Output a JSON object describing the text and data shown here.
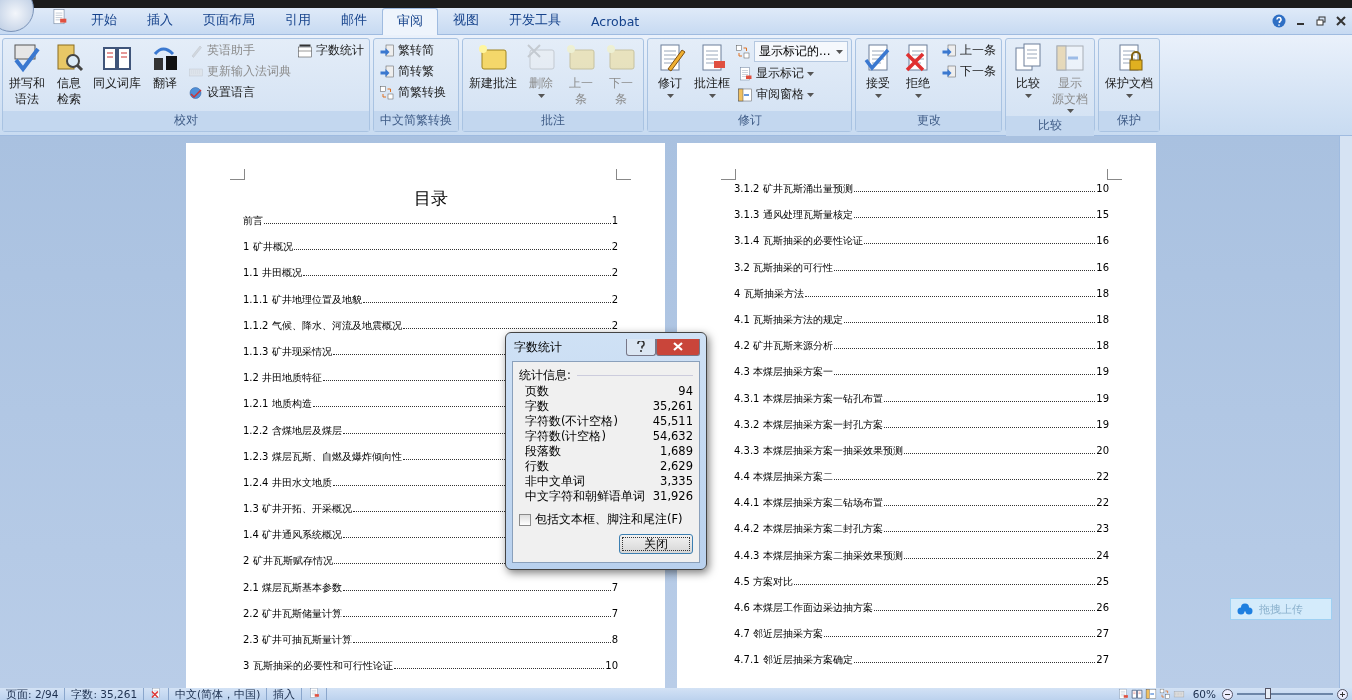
{
  "tabs": [
    {
      "label": "开始",
      "selected": false
    },
    {
      "label": "插入",
      "selected": false
    },
    {
      "label": "页面布局",
      "selected": false
    },
    {
      "label": "引用",
      "selected": false
    },
    {
      "label": "邮件",
      "selected": false
    },
    {
      "label": "审阅",
      "selected": true
    },
    {
      "label": "视图",
      "selected": false
    },
    {
      "label": "开发工具",
      "selected": false
    },
    {
      "label": "Acrobat",
      "selected": false
    }
  ],
  "ribbon": {
    "groups": [
      {
        "label": "校对",
        "columns": [
          [
            {
              "kind": "large",
              "label": [
                "拼写和",
                "语法"
              ],
              "disabled": false,
              "has_menu": false
            }
          ],
          [
            {
              "kind": "large",
              "label": [
                "信息",
                "检索"
              ],
              "disabled": false,
              "has_menu": false
            }
          ],
          [
            {
              "kind": "large",
              "label": "同义词库",
              "disabled": false,
              "has_menu": false
            }
          ],
          [
            {
              "kind": "large",
              "label": "翻译",
              "disabled": false,
              "has_menu": false
            }
          ],
          [
            {
              "kind": "small",
              "label": "英语助手",
              "disabled": true,
              "has_menu": false
            },
            {
              "kind": "small",
              "label": "更新输入法词典",
              "disabled": true,
              "has_menu": false
            },
            {
              "kind": "small",
              "label": "设置语言",
              "disabled": false,
              "has_menu": false
            }
          ],
          [
            {
              "kind": "small",
              "label": "字数统计",
              "disabled": false,
              "has_menu": false
            }
          ]
        ]
      },
      {
        "label": "中文简繁转换",
        "columns": [
          [
            {
              "kind": "small",
              "label": "繁转简",
              "disabled": false,
              "has_menu": false
            },
            {
              "kind": "small",
              "label": "简转繁",
              "disabled": false,
              "has_menu": false
            },
            {
              "kind": "small",
              "label": "简繁转换",
              "disabled": false,
              "has_menu": false
            }
          ]
        ]
      },
      {
        "label": "批注",
        "columns": [
          [
            {
              "kind": "large",
              "label": "新建批注",
              "disabled": false,
              "has_menu": false
            }
          ],
          [
            {
              "kind": "large",
              "label": "删除",
              "disabled": true,
              "has_menu": true
            }
          ],
          [
            {
              "kind": "large",
              "label": [
                "上一",
                "条"
              ],
              "disabled": true,
              "has_menu": false
            }
          ],
          [
            {
              "kind": "large",
              "label": [
                "下一",
                "条"
              ],
              "disabled": true,
              "has_menu": false
            }
          ]
        ]
      },
      {
        "label": "修订",
        "columns": [
          [
            {
              "kind": "large",
              "label": "修订",
              "disabled": false,
              "has_menu": true
            }
          ],
          [
            {
              "kind": "large",
              "label": "批注框",
              "disabled": false,
              "has_menu": true
            }
          ],
          [
            {
              "kind": "combo",
              "label": "显示标记的...",
              "disabled": false,
              "has_menu": true
            },
            {
              "kind": "small",
              "label": "显示标记",
              "disabled": false,
              "has_menu": true
            },
            {
              "kind": "small",
              "label": "审阅窗格",
              "disabled": false,
              "has_menu": true
            }
          ]
        ]
      },
      {
        "label": "更改",
        "columns": [
          [
            {
              "kind": "large",
              "label": "接受",
              "disabled": false,
              "has_menu": true
            }
          ],
          [
            {
              "kind": "large",
              "label": "拒绝",
              "disabled": false,
              "has_menu": true
            }
          ],
          [
            {
              "kind": "small",
              "label": "上一条",
              "disabled": false,
              "has_menu": false
            },
            {
              "kind": "small",
              "label": "下一条",
              "disabled": false,
              "has_menu": false
            }
          ]
        ]
      },
      {
        "label": "比较",
        "columns": [
          [
            {
              "kind": "large",
              "label": "比较",
              "disabled": false,
              "has_menu": true
            }
          ],
          [
            {
              "kind": "large",
              "label": [
                "显示",
                "源文档"
              ],
              "disabled": true,
              "has_menu": true
            }
          ]
        ]
      },
      {
        "label": "保护",
        "columns": [
          [
            {
              "kind": "large",
              "label": "保护文档",
              "disabled": false,
              "has_menu": true
            }
          ]
        ]
      }
    ]
  },
  "pages": [
    {
      "heading": "目录",
      "entries": [
        {
          "title": "前言",
          "page": "1"
        },
        {
          "title": "1  矿井概况",
          "page": "2"
        },
        {
          "title": "1.1 井田概况",
          "page": "2"
        },
        {
          "title": "1.1.1 矿井地理位置及地貌",
          "page": "2"
        },
        {
          "title": "1.1.2 气候、降水、河流及地震概况",
          "page": "2"
        },
        {
          "title": "1.1.3 矿井现采情况"
        },
        {
          "title": "1.2 井田地质特征"
        },
        {
          "title": "1.2.1 地质构造"
        },
        {
          "title": "1.2.2 含煤地层及煤层"
        },
        {
          "title": "1.2.3 煤层瓦斯、自燃及爆炸倾向性"
        },
        {
          "title": "1.2.4 井田水文地质"
        },
        {
          "title": "1.3 矿井开拓、开采概况"
        },
        {
          "title": "1.4 矿井通风系统概况"
        },
        {
          "title": "2  矿井瓦斯赋存情况"
        },
        {
          "title": "2.1 煤层瓦斯基本参数",
          "page": "7"
        },
        {
          "title": "2.2 矿井瓦斯储量计算",
          "page": "7"
        },
        {
          "title": "2.3 矿井可抽瓦斯量计算",
          "page": "8"
        },
        {
          "title": "3  瓦斯抽采的必要性和可行性论证",
          "page": "10"
        }
      ]
    },
    {
      "entries": [
        {
          "title": "3.1.2 矿井瓦斯涌出量预测",
          "page": "10"
        },
        {
          "title": "3.1.3 通风处理瓦斯量核定",
          "page": "15"
        },
        {
          "title": "3.1.4 瓦斯抽采的必要性论证",
          "page": "16"
        },
        {
          "title": "3.2 瓦斯抽采的可行性",
          "page": "16"
        },
        {
          "title": "4  瓦斯抽采方法",
          "page": "18"
        },
        {
          "title": "4.1 瓦斯抽采方法的规定",
          "page": "18"
        },
        {
          "title": "4.2 矿井瓦斯来源分析",
          "page": "18"
        },
        {
          "title": "4.3 本煤层抽采方案一",
          "page": "19"
        },
        {
          "title": "4.3.1 本煤层抽采方案一钻孔布置",
          "page": "19"
        },
        {
          "title": "4.3.2 本煤层抽采方案一封孔方案",
          "page": "19"
        },
        {
          "title": "4.3.3 本煤层抽采方案一抽采效果预测",
          "page": "20"
        },
        {
          "title": "4.4 本煤层抽采方案二",
          "page": "22"
        },
        {
          "title": "4.4.1 本煤层抽采方案二钻场布置",
          "page": "22"
        },
        {
          "title": "4.4.2 本煤层抽采方案二封孔方案",
          "page": "23"
        },
        {
          "title": "4.4.3 本煤层抽采方案二抽采效果预测",
          "page": "24"
        },
        {
          "title": "4.5 方案对比",
          "page": "25"
        },
        {
          "title": "4.6 本煤层工作面边采边抽方案",
          "page": "26"
        },
        {
          "title": "4.7 邻近层抽采方案",
          "page": "27"
        },
        {
          "title": "4.7.1 邻近层抽采方案确定",
          "page": "27"
        }
      ]
    }
  ],
  "dialog": {
    "title": "字数统计",
    "section": "统计信息:",
    "stats": [
      {
        "label": "页数",
        "value": "94"
      },
      {
        "label": "字数",
        "value": "35,261"
      },
      {
        "label": "字符数(不计空格)",
        "value": "45,511"
      },
      {
        "label": "字符数(计空格)",
        "value": "54,632"
      },
      {
        "label": "段落数",
        "value": "1,689"
      },
      {
        "label": "行数",
        "value": "2,629"
      },
      {
        "label": "非中文单词",
        "value": "3,335"
      },
      {
        "label": "中文字符和朝鲜语单词",
        "value": "31,926"
      }
    ],
    "checkbox": {
      "label": "包括文本框、脚注和尾注(F)",
      "checked": false
    },
    "button": "关闭"
  },
  "upload_button": "拖拽上传",
  "status_bar": {
    "page": "页面: 2/94",
    "words": "字数: 35,261",
    "language": "中文(简体，中国)",
    "mode": "插入",
    "zoom": "60%",
    "zoom_slider": {
      "level": 0.32
    }
  }
}
